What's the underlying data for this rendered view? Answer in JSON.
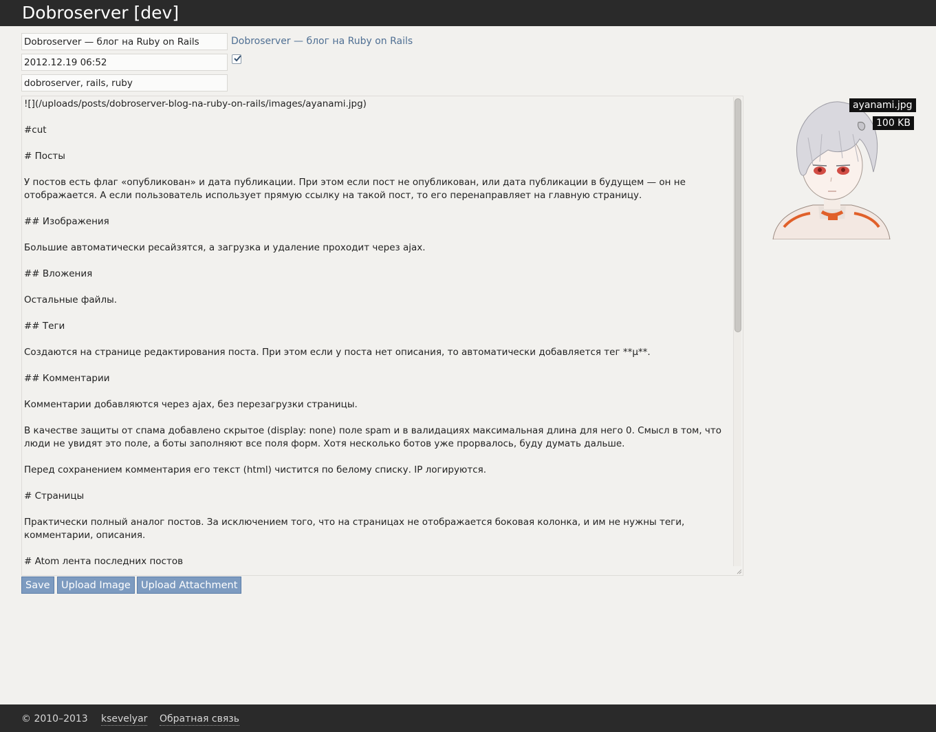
{
  "header": {
    "site_title": "Dobroserver [dev]"
  },
  "form": {
    "title_value": "Dobroserver — блог на Ruby on Rails",
    "title_link_text": "Dobroserver — блог на Ruby on Rails",
    "date_value": "2012.12.19 06:52",
    "published_checked": true,
    "tags_value": "dobroserver, rails, ruby",
    "body_value": "![](/uploads/posts/dobroserver-blog-na-ruby-on-rails/images/ayanami.jpg)\n\n#cut\n\n# Посты\n\nУ постов есть флаг «опубликован» и дата публикации. При этом если пост не опубликован, или дата публикации в будущем — он не отображается. А если пользователь использует прямую ссылку на такой пост, то его перенаправляет на главную страницу.\n\n## Изображения\n\nБольшие автоматически ресайзятся, а загрузка и удаление проходит через ajax.\n\n## Вложения\n\nОстальные файлы.\n\n## Теги\n\nСоздаются на странице редактирования поста. При этом если у поста нет описания, то автоматически добавляется тег **µ**.\n\n## Комментарии\n\nКомментарии добавляются через ajax, без перезагрузки страницы.\n\nВ качестве защиты от спама добавлено скрытое (display: none) поле spam и в валидациях максимальная длина для него 0. Смысл в том, что люди не увидят это поле, а боты заполняют все поля форм. Хотя несколько ботов уже прорвалось, буду думать дальше.\n\nПеред сохранением комментария его текст (html) чистится по белому списку. IP логируются.\n\n# Страницы\n\nПрактически полный аналог постов. За исключением того, что на страницах не отображается боковая колонка, и им не нужны теги, комментарии, описания.\n\n# Atom лента последних постов"
  },
  "buttons": {
    "save": "Save",
    "upload_image": "Upload Image",
    "upload_attachment": "Upload Attachment"
  },
  "image_preview": {
    "filename": "ayanami.jpg",
    "size": "100 KB"
  },
  "footer": {
    "copyright": "© 2010–2013",
    "author": "ksevelyar",
    "feedback": "Обратная связь"
  },
  "colors": {
    "topbar_bg": "#2a2a2a",
    "page_bg": "#f2f1ee",
    "link": "#4f6f93",
    "button_bg": "#7d9bc0"
  }
}
